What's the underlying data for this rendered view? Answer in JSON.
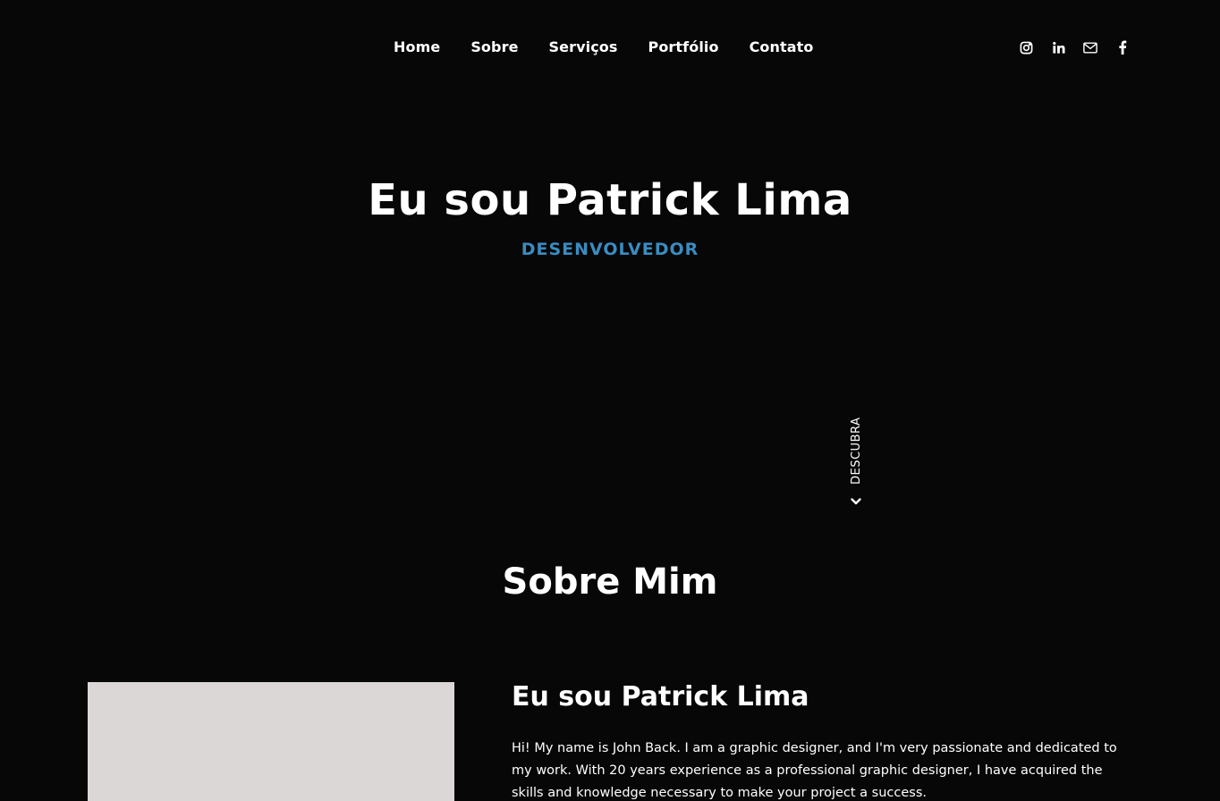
{
  "nav": {
    "items": [
      {
        "label": "Home"
      },
      {
        "label": "Sobre"
      },
      {
        "label": "Serviços"
      },
      {
        "label": "Portfólio"
      },
      {
        "label": "Contato"
      }
    ]
  },
  "social": {
    "icons": [
      "instagram-icon",
      "linkedin-icon",
      "mail-icon",
      "facebook-icon"
    ]
  },
  "hero": {
    "title": "Eu sou Patrick Lima",
    "subtitle": "DESENVOLVEDOR",
    "subtitle_color": "#3a8cc0"
  },
  "discover": {
    "label": "DESCUBRA"
  },
  "about": {
    "title": "Sobre Mim",
    "name": "Eu sou Patrick Lima",
    "text": "Hi! My name is John Back. I am a graphic designer, and I'm very passionate and dedicated to my work. With 20 years experience as a professional graphic designer, I have acquired the skills and knowledge necessary to make your project a success.",
    "photo_color": "#dcd7d7"
  }
}
